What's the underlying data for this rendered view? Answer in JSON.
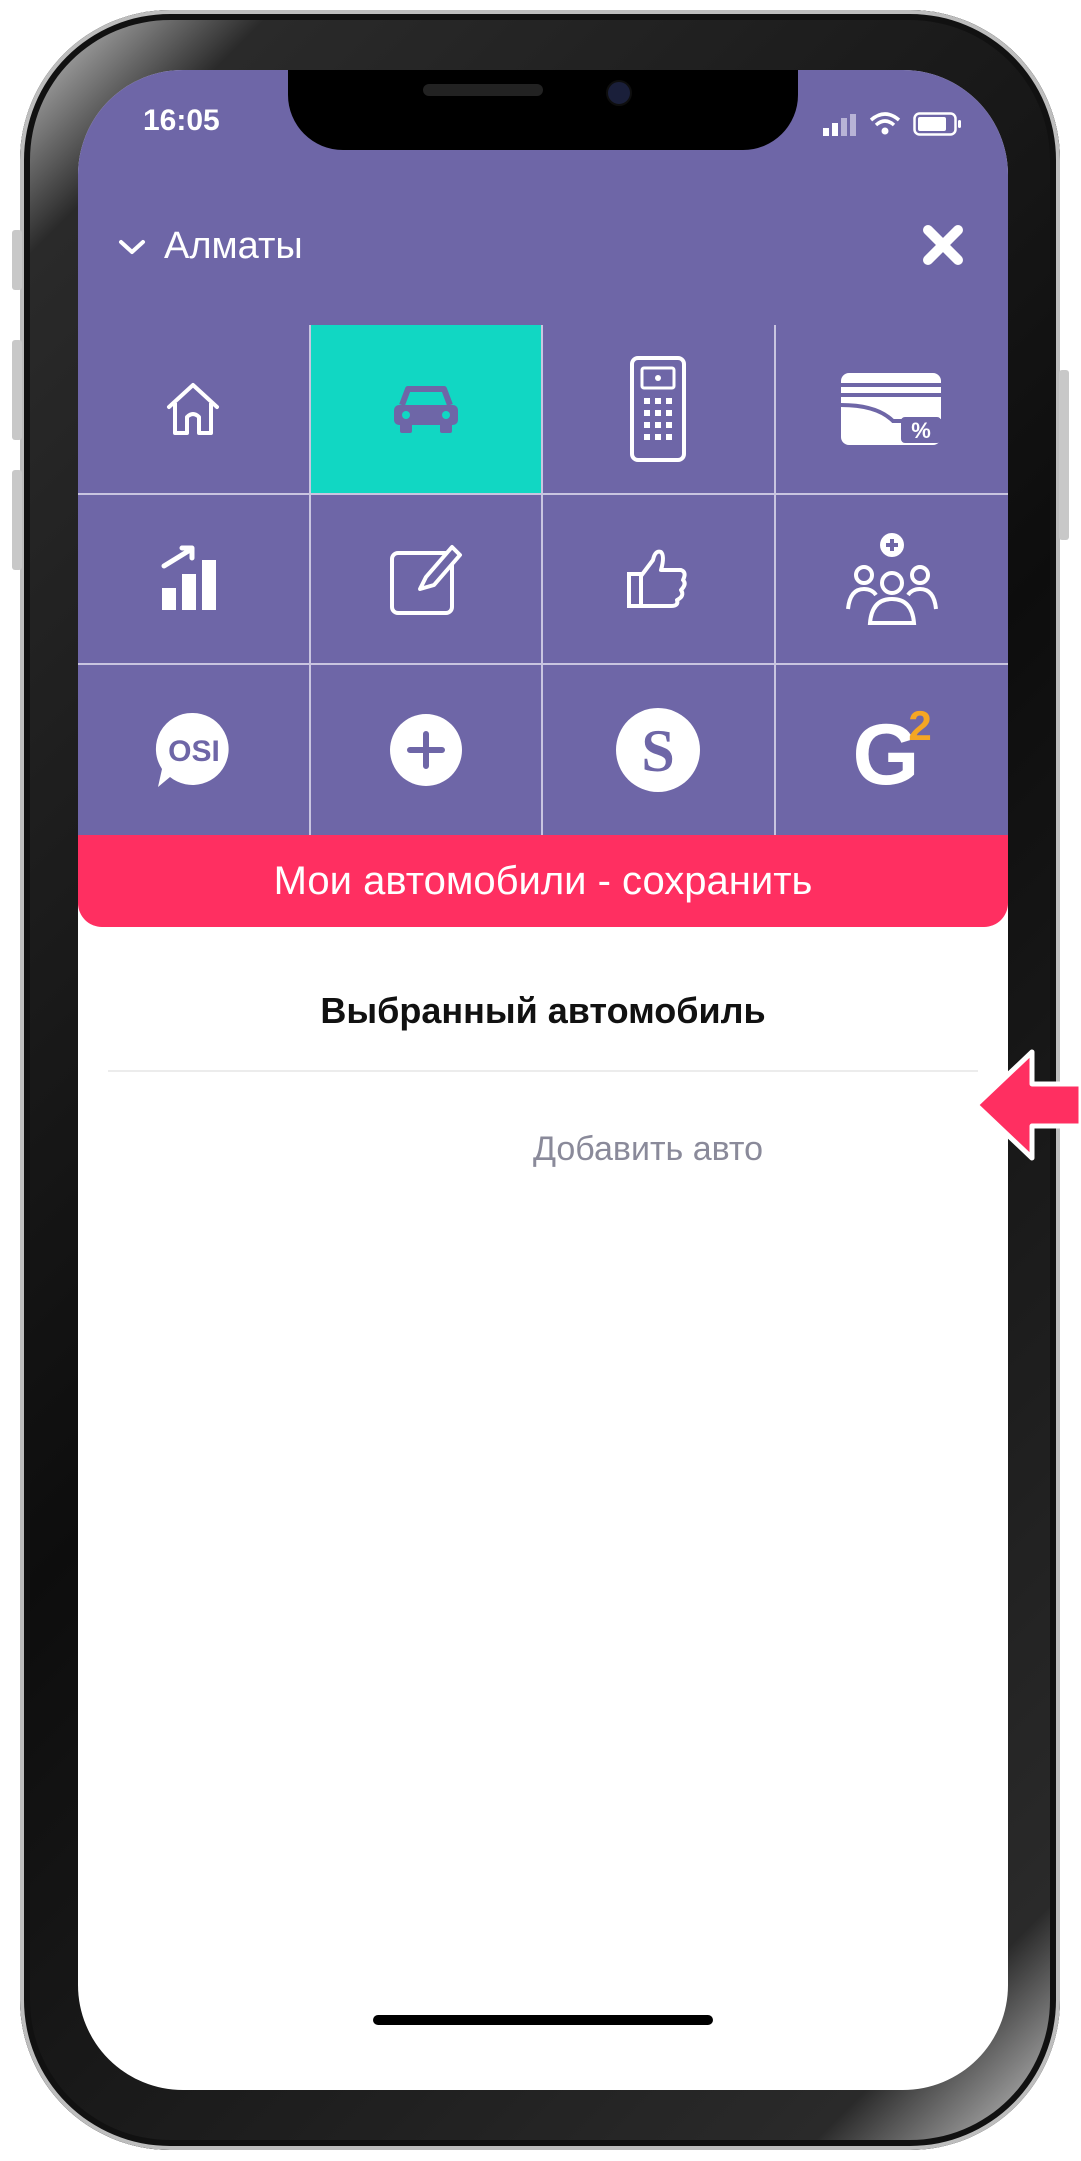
{
  "status_bar": {
    "time": "16:05"
  },
  "header": {
    "city": "Алматы"
  },
  "grid": {
    "tiles": [
      {
        "icon": "home-icon"
      },
      {
        "icon": "car-icon",
        "active": true
      },
      {
        "icon": "intercom-icon"
      },
      {
        "icon": "wallet-discount-icon"
      },
      {
        "icon": "bar-chart-icon"
      },
      {
        "icon": "edit-icon"
      },
      {
        "icon": "thumbs-up-icon"
      },
      {
        "icon": "add-group-icon"
      },
      {
        "icon": "osi-icon",
        "label": "OSI"
      },
      {
        "icon": "plus-circle-icon"
      },
      {
        "icon": "s-logo-icon",
        "label": "S"
      },
      {
        "icon": "g2-logo-icon",
        "label": "G",
        "superscript": "2"
      }
    ]
  },
  "save_button": {
    "label": "Мои автомобили - сохранить"
  },
  "selected_car": {
    "title": "Выбранный автомобиль"
  },
  "add_car": {
    "label": "Добавить авто"
  },
  "colors": {
    "primary": "#6e66a7",
    "active_tile": "#11d7c3",
    "accent": "#ff2f61",
    "g2_orange": "#f5a623"
  }
}
